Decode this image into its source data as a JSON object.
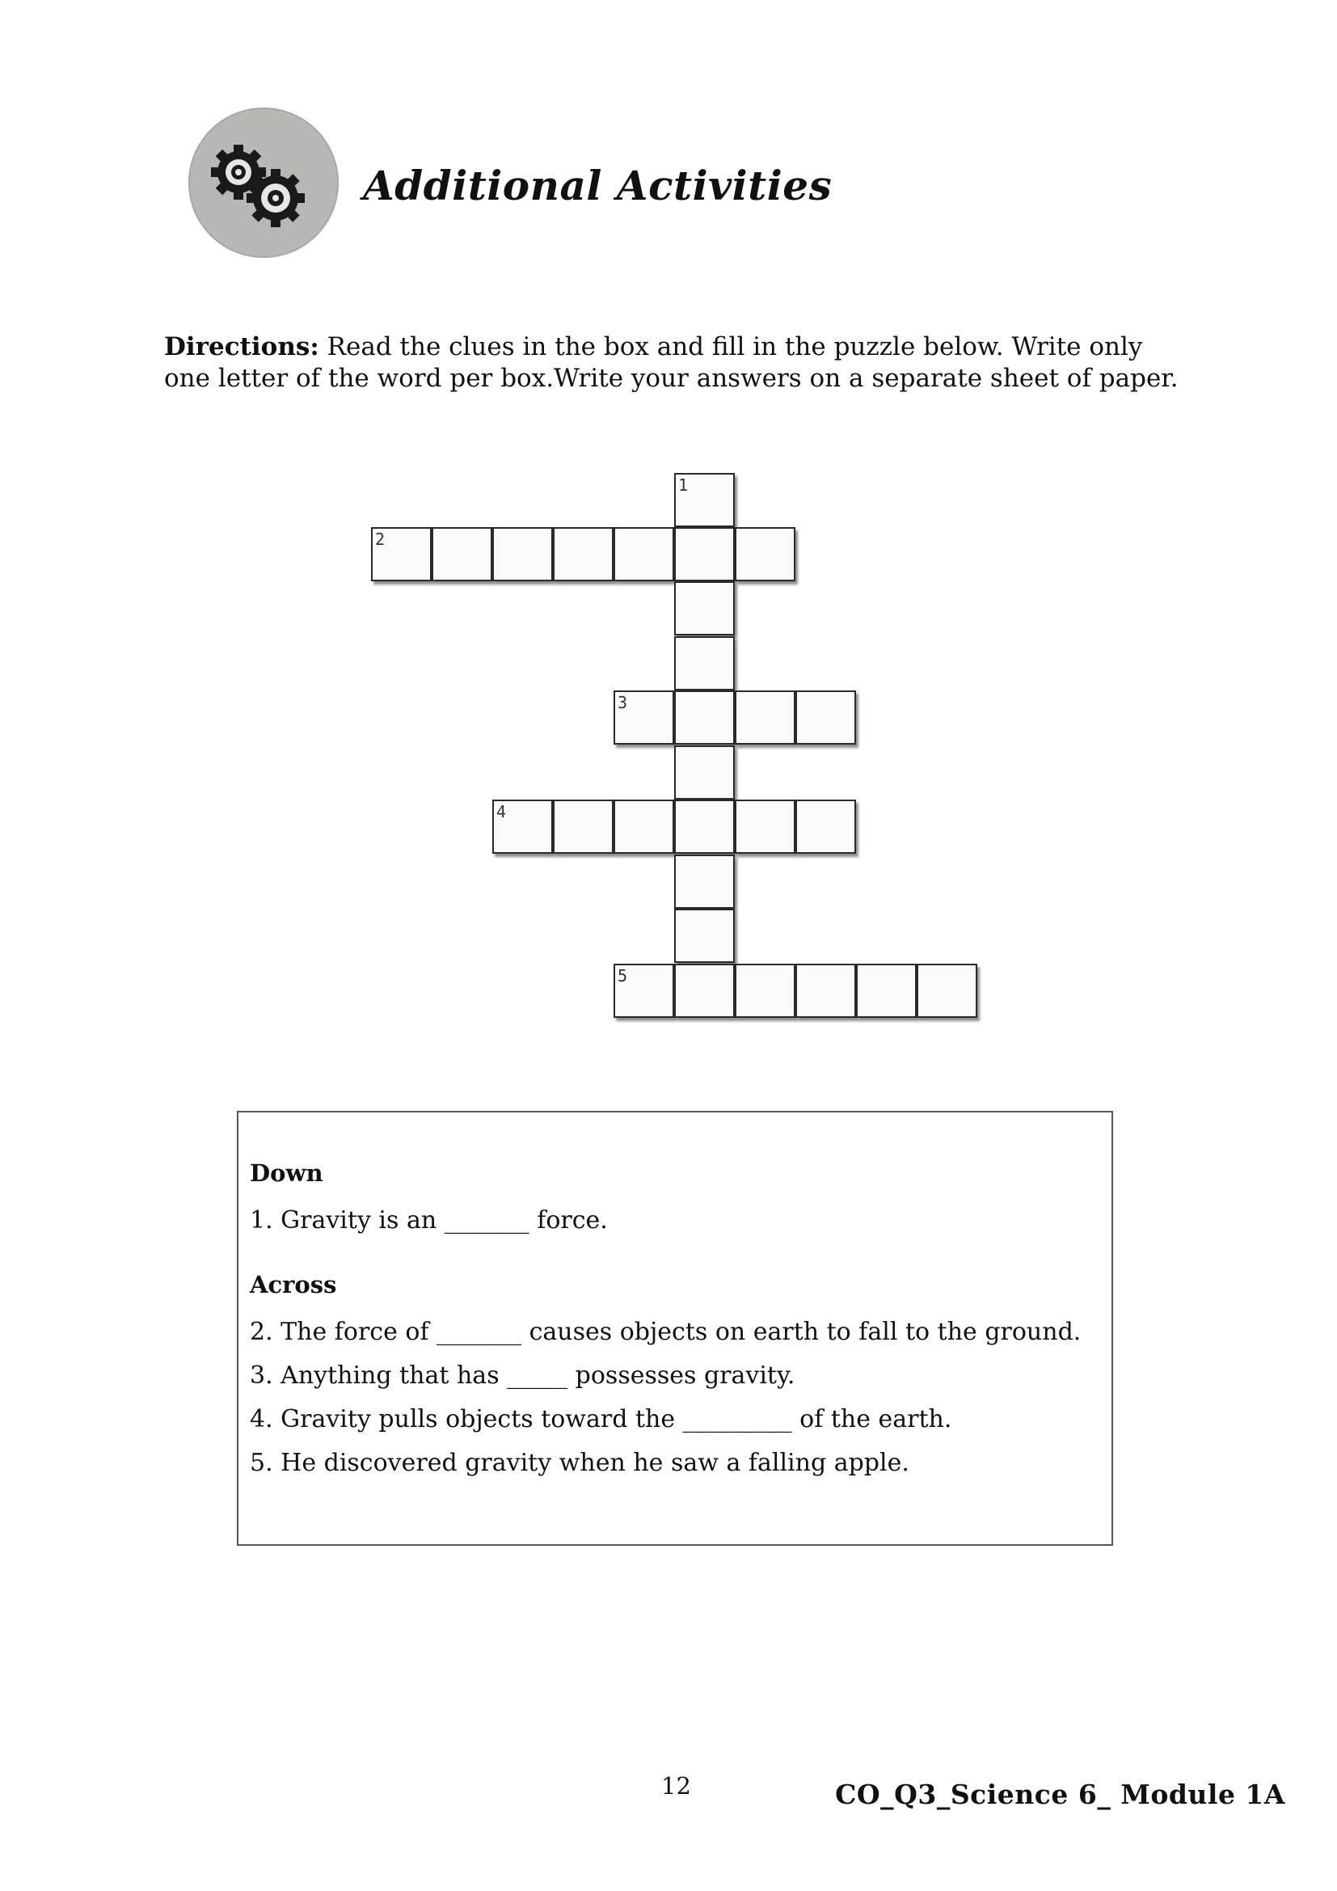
{
  "header": {
    "icon": "gears-icon",
    "title": "Additional Activities"
  },
  "directions": {
    "label": "Directions:",
    "text": " Read the clues in the box and fill in the puzzle below. Write only one letter of the word per box.Write your answers on a separate sheet of paper."
  },
  "crossword": {
    "numbers": [
      "1",
      "2",
      "3",
      "4",
      "5"
    ]
  },
  "clues": {
    "down_heading": "Down",
    "down": [
      "1.  Gravity is an _______ force."
    ],
    "across_heading": "Across",
    "across": [
      "2. The force of _______ causes objects on earth to fall to the ground.",
      "3. Anything that has _____ possesses gravity.",
      "4. Gravity pulls objects toward the _________ of the earth.",
      "5. He discovered gravity when he saw a falling apple."
    ]
  },
  "footer": {
    "page_number": "12",
    "module_code": "CO_Q3_Science 6_ Module 1A"
  }
}
